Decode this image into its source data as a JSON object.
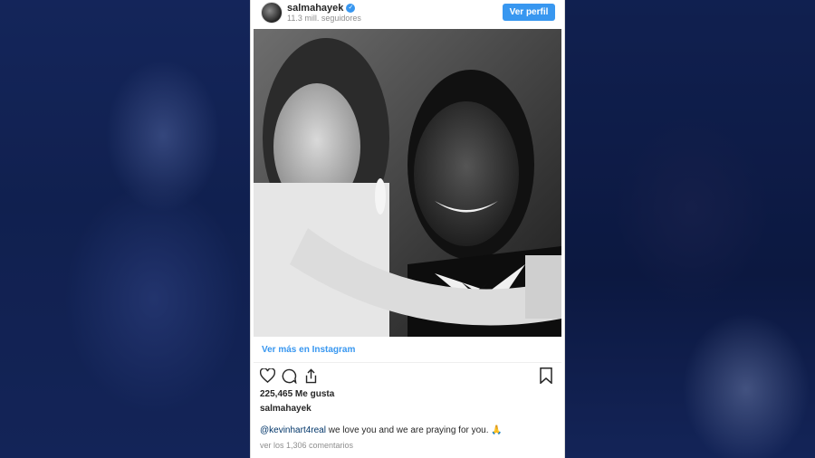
{
  "post": {
    "username": "salmahayek",
    "verified_icon": "verified-badge-icon",
    "followers": "11.3 mill. seguidores",
    "view_profile_label": "Ver perfil",
    "view_more_label": "Ver más en Instagram",
    "likes": "225,465 Me gusta",
    "caption_user": "salmahayek",
    "caption_mention": "@kevinhart4real",
    "caption_text": " we love you and we are praying for you. 🙏",
    "comments_link": "ver los 1,306 comentarios"
  },
  "icons": {
    "like": "heart-icon",
    "comment": "comment-icon",
    "share": "share-icon",
    "save": "bookmark-icon"
  },
  "colors": {
    "accent": "#3897f0",
    "background": "#0f1c40",
    "text": "#262626",
    "muted": "#8e8e8e"
  }
}
